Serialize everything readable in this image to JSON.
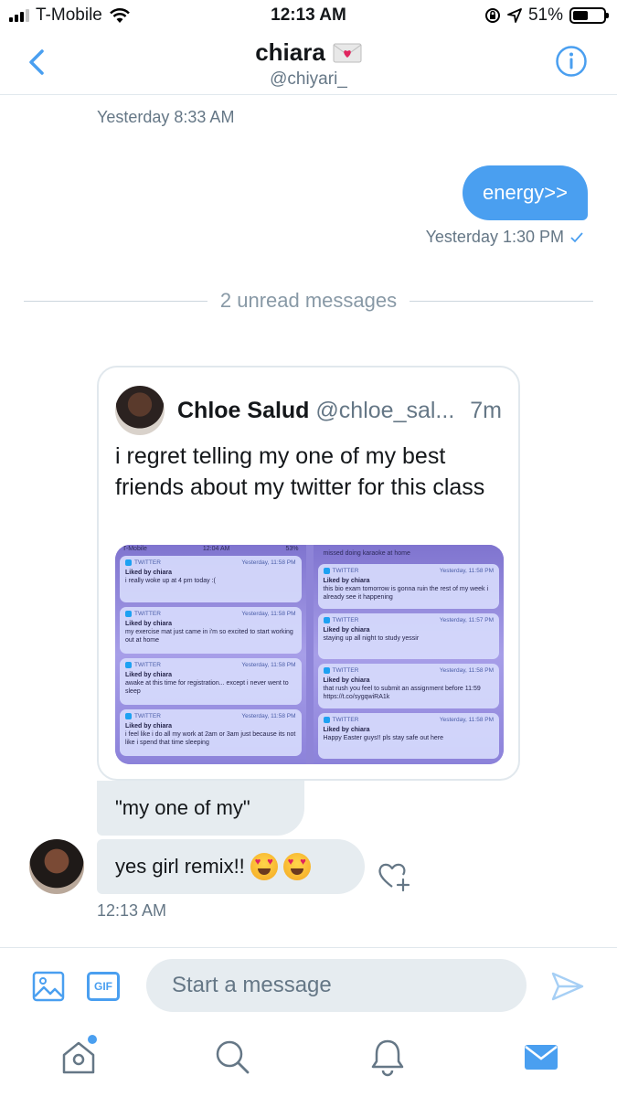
{
  "status_bar": {
    "carrier": "T-Mobile",
    "time": "12:13 AM",
    "battery_percent": "51%",
    "battery_level": 0.51
  },
  "header": {
    "name": "chiara",
    "handle": "@chiyari_"
  },
  "messages": {
    "ts_1": "Yesterday 8:33 AM",
    "outgoing_text": "energy>>",
    "ts_2": "Yesterday 1:30 PM",
    "unread_divider": "2 unread messages",
    "tweet": {
      "name": "Chloe Salud",
      "handle": "@chloe_sal...",
      "age": "7m",
      "text": "i regret telling my one of my best friends about my twitter for this class",
      "media": {
        "status_time": "12:04 AM",
        "status_carrier": "T-Mobile",
        "status_battery": "53%",
        "top_right_text": "missed doing karaoke at home",
        "left": [
          {
            "app": "TWITTER",
            "time": "Yesterday, 11:58 PM",
            "liked": "Liked by chiara",
            "body": "i really woke up at 4 pm today :("
          },
          {
            "app": "TWITTER",
            "time": "Yesterday, 11:58 PM",
            "liked": "Liked by chiara",
            "body": "my exercise mat just came in i'm so excited to start working out at home"
          },
          {
            "app": "TWITTER",
            "time": "Yesterday, 11:58 PM",
            "liked": "Liked by chiara",
            "body": "awake at this time for registration... except i never went to sleep"
          },
          {
            "app": "TWITTER",
            "time": "Yesterday, 11:58 PM",
            "liked": "Liked by chiara",
            "body": "i feel like i do all my work at 2am or 3am just because its not like i spend that time sleeping"
          }
        ],
        "right": [
          {
            "app": "TWITTER",
            "time": "Yesterday, 11:58 PM",
            "liked": "Liked by chiara",
            "body": "this bio exam tomorrow is gonna ruin the rest of my week i already see it happening"
          },
          {
            "app": "TWITTER",
            "time": "Yesterday, 11:57 PM",
            "liked": "Liked by chiara",
            "body": "staying up all night to study yessir"
          },
          {
            "app": "TWITTER",
            "time": "Yesterday, 11:58 PM",
            "liked": "Liked by chiara",
            "body": "that rush you feel to submit an assignment before 11:59 https://t.co/sygqwiRA1k"
          },
          {
            "app": "TWITTER",
            "time": "Yesterday, 11:58 PM",
            "liked": "Liked by chiara",
            "body": "Happy Easter guys!! pls stay safe out here"
          }
        ]
      }
    },
    "incoming_1": "\"my one of my\"",
    "incoming_2": "yes girl remix!!",
    "ts_3": "12:13 AM"
  },
  "composer": {
    "gif_label": "GIF",
    "placeholder": "Start a message"
  },
  "colors": {
    "accent": "#4a9ff0",
    "bubble_in": "#e6ecf0",
    "muted_text": "#657786"
  },
  "icons": {
    "back": "chevron-left-icon",
    "info": "info-icon",
    "like": "heart-plus-icon",
    "image": "image-icon",
    "send": "send-icon",
    "home": "home-icon",
    "search": "search-icon",
    "notifications": "bell-icon",
    "messages": "envelope-icon"
  }
}
